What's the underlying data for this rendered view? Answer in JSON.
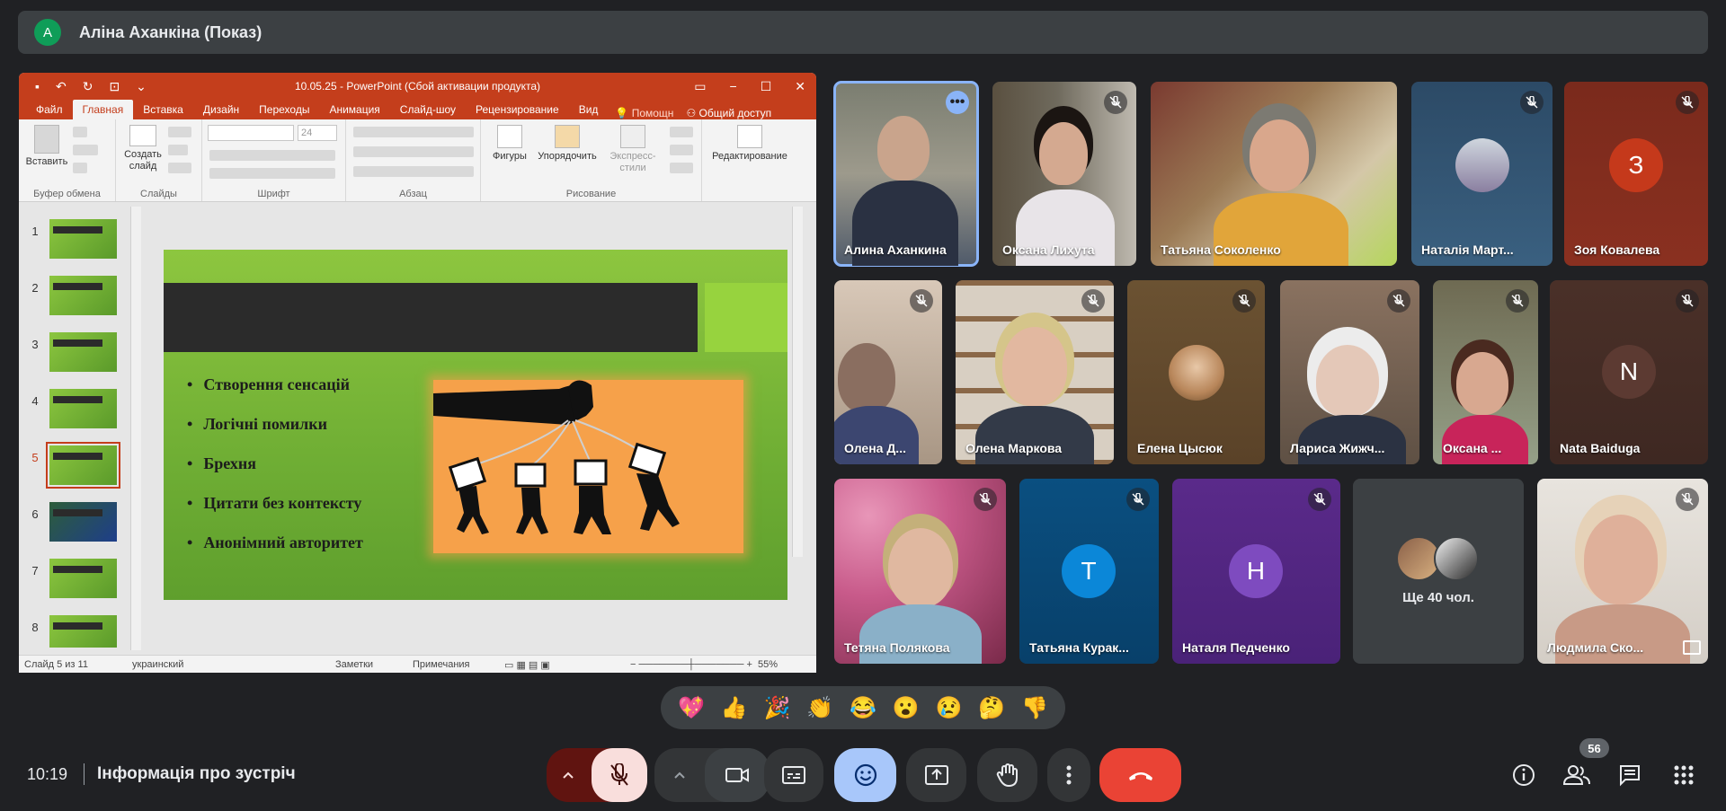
{
  "presenter": {
    "initial": "A",
    "name": "Аліна Аханкіна (Показ)"
  },
  "powerpoint": {
    "doc_title": "10.05.25 - PowerPoint (Сбой активации продукта)",
    "tabs": [
      "Файл",
      "Главная",
      "Вставка",
      "Дизайн",
      "Переходы",
      "Анимация",
      "Слайд-шоу",
      "Рецензирование",
      "Вид"
    ],
    "active_tab": "Главная",
    "tell_me": "Помощн",
    "share": "Общий доступ",
    "ribbon": {
      "paste": "Вставить",
      "new_slide": "Создать слайд",
      "shapes": "Фигуры",
      "arrange": "Упорядочить",
      "quick_styles": "Экспресс-стили",
      "editing": "Редактирование",
      "font_size": "24",
      "groups": [
        "Буфер обмена",
        "Слайды",
        "Шрифт",
        "Абзац",
        "Рисование"
      ]
    },
    "thumbnails": [
      "1",
      "2",
      "3",
      "4",
      "5",
      "6",
      "7",
      "8"
    ],
    "selected_slide": 5,
    "slide": {
      "bullets": [
        "Створення сенсацій",
        "Логічні помилки",
        "Брехня",
        "Цитати без контексту",
        "Анонімний авторитет"
      ]
    },
    "status": {
      "slide_counter": "Слайд 5 из 11",
      "language": "украинский",
      "notes": "Заметки",
      "comments": "Примечания",
      "zoom": "55%"
    }
  },
  "participants": [
    {
      "name": "Алина Аханкина",
      "muted": false,
      "speaking": true
    },
    {
      "name": "Оксана Лихута",
      "muted": true
    },
    {
      "name": "Татьяна Соколенко",
      "muted": false
    },
    {
      "name": "Наталія Март...",
      "muted": true
    },
    {
      "name": "Зоя Ковалева",
      "initial": "З",
      "avatar_color": "#c5391b",
      "muted": true
    },
    {
      "name": "Олена Д...",
      "muted": true
    },
    {
      "name": "Олена Маркова",
      "muted": true
    },
    {
      "name": "Елена Цысюк",
      "muted": true
    },
    {
      "name": "Лариса Жижч...",
      "muted": true
    },
    {
      "name": "Оксана ...",
      "muted": true
    },
    {
      "name": "Nata Baiduga",
      "initial": "N",
      "avatar_color": "#5c3a32",
      "muted": true
    },
    {
      "name": "Тетяна Полякова",
      "muted": true
    },
    {
      "name": "Татьяна Курак...",
      "initial": "T",
      "avatar_color": "#0b87d8",
      "muted": true
    },
    {
      "name": "Наталя Педченко",
      "initial": "H",
      "avatar_color": "#7e4bbf",
      "muted": true
    },
    {
      "name": "Людмила Ско...",
      "muted": true
    }
  ],
  "others": {
    "label": "Ще 40 чол."
  },
  "reactions": [
    "💖",
    "👍",
    "🎉",
    "👏",
    "😂",
    "😮",
    "😢",
    "🤔",
    "👎"
  ],
  "bottom": {
    "time": "10:19",
    "meeting_info": "Інформація про зустріч",
    "people_count": "56"
  },
  "colors": {
    "background": "#202124",
    "end_call": "#ea4335",
    "mic_off": "#f9dedc",
    "active_reaction": "#a8c7fa",
    "ppt_red": "#c43e1c"
  }
}
